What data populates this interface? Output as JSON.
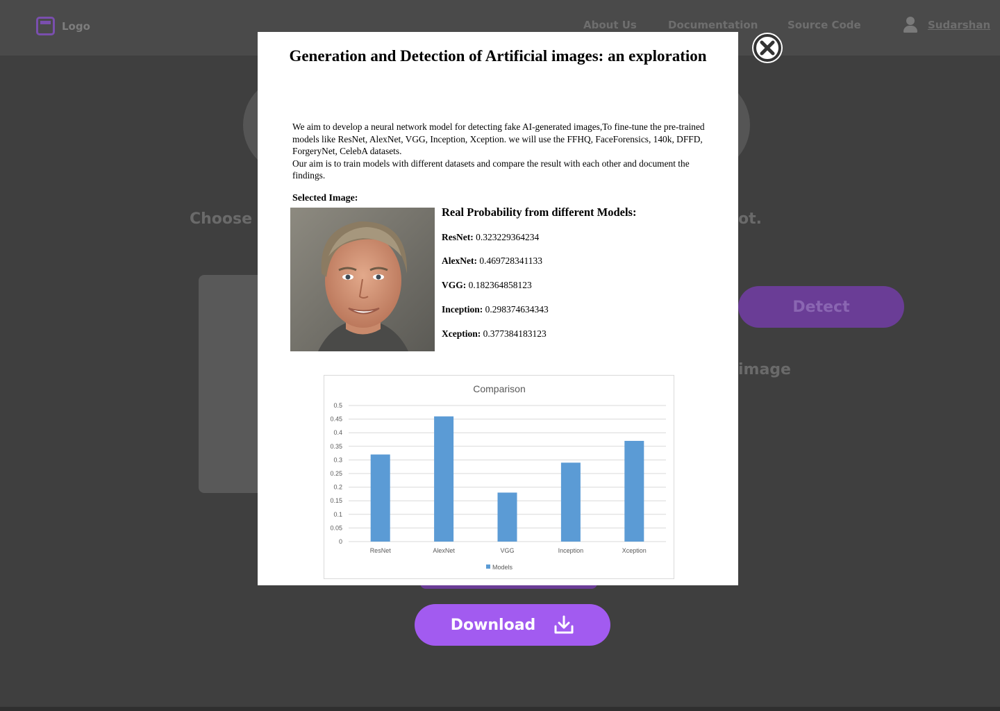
{
  "nav": {
    "logo": "Logo",
    "links": [
      "About Us",
      "Documentation",
      "Source Code"
    ],
    "user": "Sudarshan"
  },
  "background": {
    "prompt_left": "Choose",
    "prompt_right": "ot.",
    "detect_label": "Detect",
    "result_label": "image"
  },
  "modal": {
    "title": "Generation and Detection of Artificial images: an exploration",
    "paragraph1": "We aim to develop a neural network model for detecting fake AI-generated images,To fine-tune the pre-trained models like ResNet, AlexNet, VGG, Inception, Xception. we will use the FFHQ, FaceForensics, 140k, DFFD, ForgeryNet, CelebA datasets.",
    "paragraph2": "Our aim is to train models with different datasets and compare the result with each other and document the findings.",
    "selected_label": "Selected Image:",
    "prob_heading": "Real Probability from different Models:",
    "models": [
      {
        "name": "ResNet:",
        "value": "0.323229364234"
      },
      {
        "name": "AlexNet:",
        "value": "0.469728341133"
      },
      {
        "name": "VGG:",
        "value": "0.182364858123"
      },
      {
        "name": "Inception:",
        "value": "0.298374634343"
      },
      {
        "name": "Xception:",
        "value": "0.377384183123"
      }
    ]
  },
  "chart_data": {
    "type": "bar",
    "title": "Comparison",
    "categories": [
      "ResNet",
      "AlexNet",
      "VGG",
      "Inception",
      "Xception"
    ],
    "series": [
      {
        "name": "Models",
        "values": [
          0.32,
          0.46,
          0.18,
          0.29,
          0.37
        ]
      }
    ],
    "ylim": [
      0,
      0.5
    ],
    "yticks": [
      "0",
      "0.05",
      "0.1",
      "0.15",
      "0.2",
      "0.25",
      "0.3",
      "0.35",
      "0.4",
      "0.45",
      "0.5"
    ],
    "grid": true,
    "legend": "bottom",
    "bar_color": "#5b9bd5"
  },
  "download": {
    "label": "Download"
  },
  "colors": {
    "accent": "#a25bf0",
    "background": "#3f3f3f"
  }
}
